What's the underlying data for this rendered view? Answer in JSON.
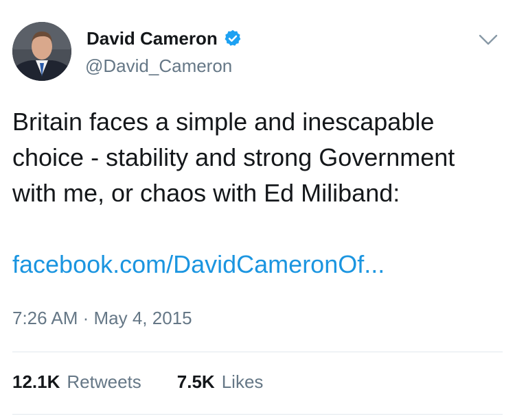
{
  "author": {
    "display_name": "David Cameron",
    "handle": "@David_Cameron",
    "verified": true
  },
  "tweet": {
    "text": "Britain faces a simple and inescapable choice - stability and strong Government with me, or chaos with Ed Miliband:",
    "link_text": "facebook.com/DavidCameronOf...",
    "timestamp": "7:26 AM · May 4, 2015"
  },
  "stats": {
    "retweets_count": "12.1K",
    "retweets_label": "Retweets",
    "likes_count": "7.5K",
    "likes_label": "Likes"
  },
  "icons": {
    "verified": "verified-badge-icon",
    "menu": "chevron-down-icon"
  },
  "colors": {
    "link": "#1b95e0",
    "verified": "#1da1f2",
    "secondary_text": "#657786",
    "primary_text": "#14171a",
    "divider": "#e1e8ed"
  }
}
